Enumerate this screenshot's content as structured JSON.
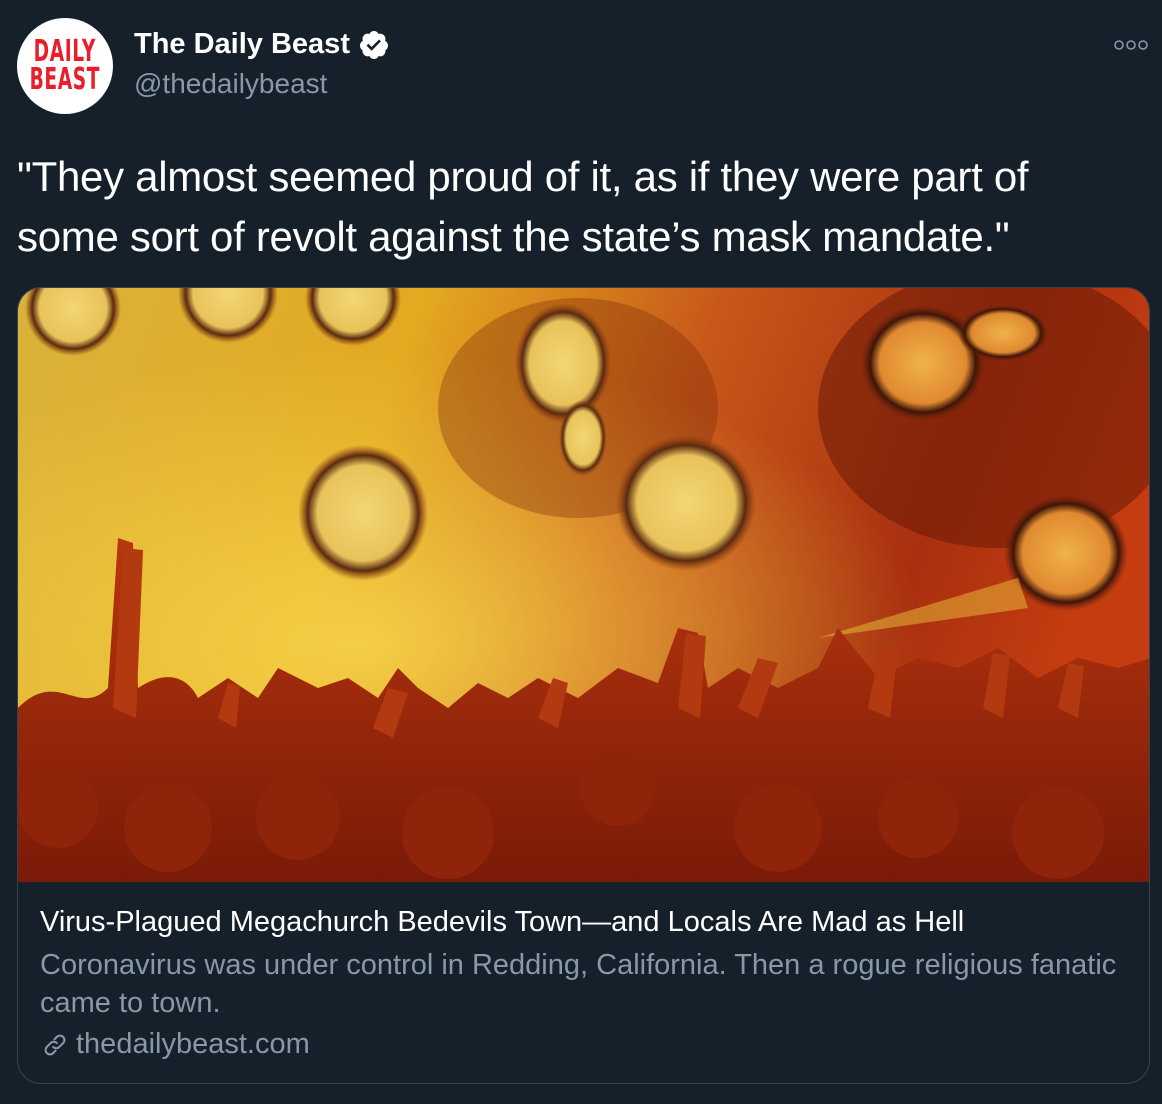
{
  "account": {
    "display_name": "The Daily Beast",
    "handle": "@thedailybeast",
    "avatar_logo_line1": "DAILY",
    "avatar_logo_line2": "BEAST",
    "verified": true
  },
  "tweet": {
    "text": "\"They almost seemed proud of it, as if they were part of some sort of revolt against the state’s mask mandate.\""
  },
  "card": {
    "title": "Virus-Plagued Megachurch Bedevils Town—and Locals Are Mad as Hell",
    "description": "Coronavirus was under control in Redding, California. Then a rogue religious fanatic came to town.",
    "domain": "thedailybeast.com",
    "image_description_icon": "virus-crowd-photo"
  },
  "icons": {
    "verified": "verified-badge-icon",
    "more": "more-options-icon",
    "link": "link-icon"
  },
  "colors": {
    "background": "#15202b",
    "secondary_text": "#8899a6",
    "border": "#38444d",
    "logo_red": "#ea1d2c"
  }
}
